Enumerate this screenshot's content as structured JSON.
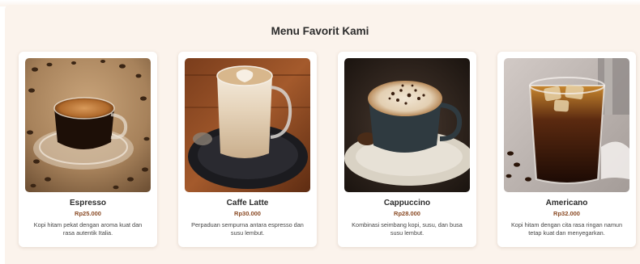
{
  "section": {
    "title": "Menu Favorit Kami"
  },
  "colors": {
    "background": "#fbf3ec",
    "card": "#ffffff",
    "title": "#2b2b2b",
    "price": "#8a4a24"
  },
  "menu": {
    "items": [
      {
        "name": "Espresso",
        "price": "Rp25.000",
        "description": "Kopi hitam pekat dengan aroma kuat dan rasa autentik Italia.",
        "image": "espresso-photo"
      },
      {
        "name": "Caffe Latte",
        "price": "Rp30.000",
        "description": "Perpaduan sempurna antara espresso dan susu lembut.",
        "image": "caffe-latte-photo"
      },
      {
        "name": "Cappuccino",
        "price": "Rp28.000",
        "description": "Kombinasi seimbang kopi, susu, dan busa susu lembut.",
        "image": "cappuccino-photo"
      },
      {
        "name": "Americano",
        "price": "Rp32.000",
        "description": "Kopi hitam dengan cita rasa ringan namun tetap kuat dan menyegarkan.",
        "image": "americano-photo"
      }
    ]
  }
}
